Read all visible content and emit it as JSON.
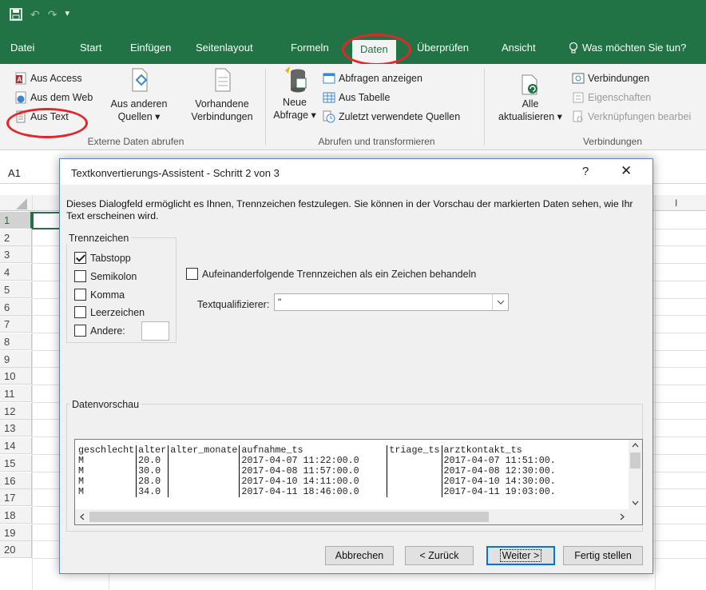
{
  "colors": {
    "excel_green": "#217346",
    "highlight_red": "#e3262a",
    "dialog_border": "#5b86c5"
  },
  "titlebar": {
    "qat_icons": [
      "save-icon",
      "undo-icon",
      "redo-icon",
      "customize-icon"
    ]
  },
  "tabs": {
    "items": [
      "Datei",
      "Start",
      "Einfügen",
      "Seitenlayout",
      "Formeln",
      "Daten",
      "Überprüfen",
      "Ansicht"
    ],
    "active": "Daten",
    "tellme": "Was möchten Sie tun?"
  },
  "ribbon": {
    "external": {
      "access": "Aus Access",
      "web": "Aus dem Web",
      "text": "Aus Text",
      "other_line1": "Aus anderen",
      "other_line2": "Quellen ▾",
      "existing_line1": "Vorhandene",
      "existing_line2": "Verbindungen",
      "group_label": "Externe Daten abrufen"
    },
    "transform": {
      "new_query_line1": "Neue",
      "new_query_line2": "Abfrage ▾",
      "show_queries": "Abfragen anzeigen",
      "from_table": "Aus Tabelle",
      "recent_sources": "Zuletzt verwendete Quellen",
      "group_label": "Abrufen und transformieren"
    },
    "connections": {
      "refresh_line1": "Alle",
      "refresh_line2": "aktualisieren ▾",
      "connections": "Verbindungen",
      "properties": "Eigenschaften",
      "edit_links": "Verknüpfungen bearbei",
      "group_label": "Verbindungen"
    }
  },
  "sheet": {
    "namebox": "A1",
    "rows": [
      "1",
      "2",
      "3",
      "4",
      "5",
      "6",
      "7",
      "8",
      "9",
      "10",
      "11",
      "12",
      "13",
      "14",
      "15",
      "16",
      "17",
      "18",
      "19",
      "20"
    ],
    "visible_column": "I"
  },
  "dialog": {
    "title": "Textkonvertierungs-Assistent - Schritt 2 von 3",
    "help": "?",
    "close": "✕",
    "description": "Dieses Dialogfeld ermöglicht es Ihnen, Trennzeichen festzulegen. Sie können in der Vorschau der markierten Daten sehen, wie Ihr Text erscheinen wird.",
    "delimiters": {
      "legend": "Trennzeichen",
      "tab": "Tabstopp",
      "semicolon": "Semikolon",
      "comma": "Komma",
      "space": "Leerzeichen",
      "other": "Andere:",
      "tab_checked": true
    },
    "consecutive": "Aufeinanderfolgende Trennzeichen als ein Zeichen behandeln",
    "text_qualifier_label": "Textqualifizierer:",
    "text_qualifier_value": "\"",
    "preview_legend": "Datenvorschau",
    "preview_rows": [
      [
        "geschlecht",
        "alter",
        "alter_monate",
        "aufnahme_ts",
        "triage_ts",
        "arztkontakt_ts"
      ],
      [
        "M",
        "20.0",
        "",
        "2017-04-07 11:22:00.0",
        "",
        "2017-04-07 11:51:00."
      ],
      [
        "M",
        "30.0",
        "",
        "2017-04-08 11:57:00.0",
        "",
        "2017-04-08 12:30:00."
      ],
      [
        "M",
        "28.0",
        "",
        "2017-04-10 14:11:00.0",
        "",
        "2017-04-10 14:30:00."
      ],
      [
        "M",
        "34.0",
        "",
        "2017-04-11 18:46:00.0",
        "",
        "2017-04-11 19:03:00."
      ]
    ],
    "buttons": {
      "cancel": "Abbrechen",
      "back": "< Zurück",
      "next": "Weiter >",
      "finish": "Fertig stellen"
    }
  }
}
